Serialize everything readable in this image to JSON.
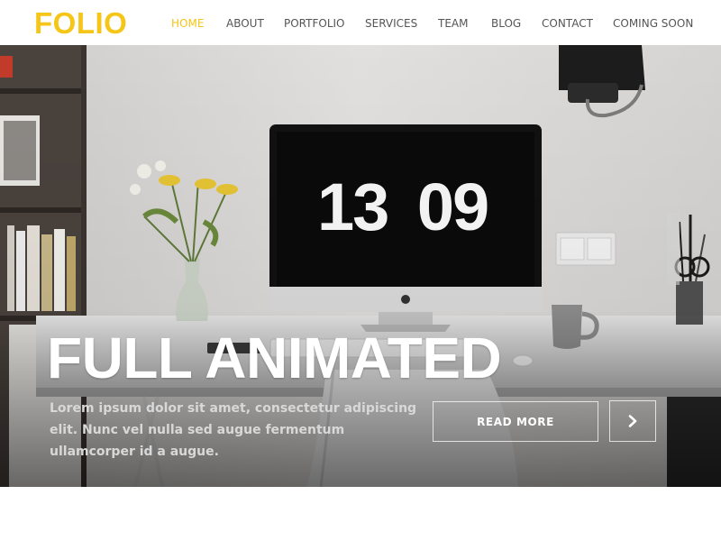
{
  "brand": {
    "logo_text": "FOLIO",
    "accent_color": "#f5c518"
  },
  "nav": {
    "items": [
      {
        "label": "HOME",
        "active": true
      },
      {
        "label": "ABOUT",
        "active": false
      },
      {
        "label": "PORTFOLIO",
        "active": false
      },
      {
        "label": "SERVICES",
        "active": false
      },
      {
        "label": "TEAM",
        "active": false
      },
      {
        "label": "BLOG",
        "active": false
      },
      {
        "label": "CONTACT",
        "active": false
      },
      {
        "label": "COMING SOON",
        "active": false
      }
    ]
  },
  "hero": {
    "screen_clock": {
      "hours": "13",
      "minutes": "09"
    },
    "title": "FULL ANIMATED",
    "text": "Lorem ipsum dolor sit amet, consectetur adipiscing elit. Nunc vel nulla sed augue fermentum ullamcorper id a augue.",
    "read_more_label": "READ MORE",
    "next_icon": "chevron-right-icon"
  }
}
